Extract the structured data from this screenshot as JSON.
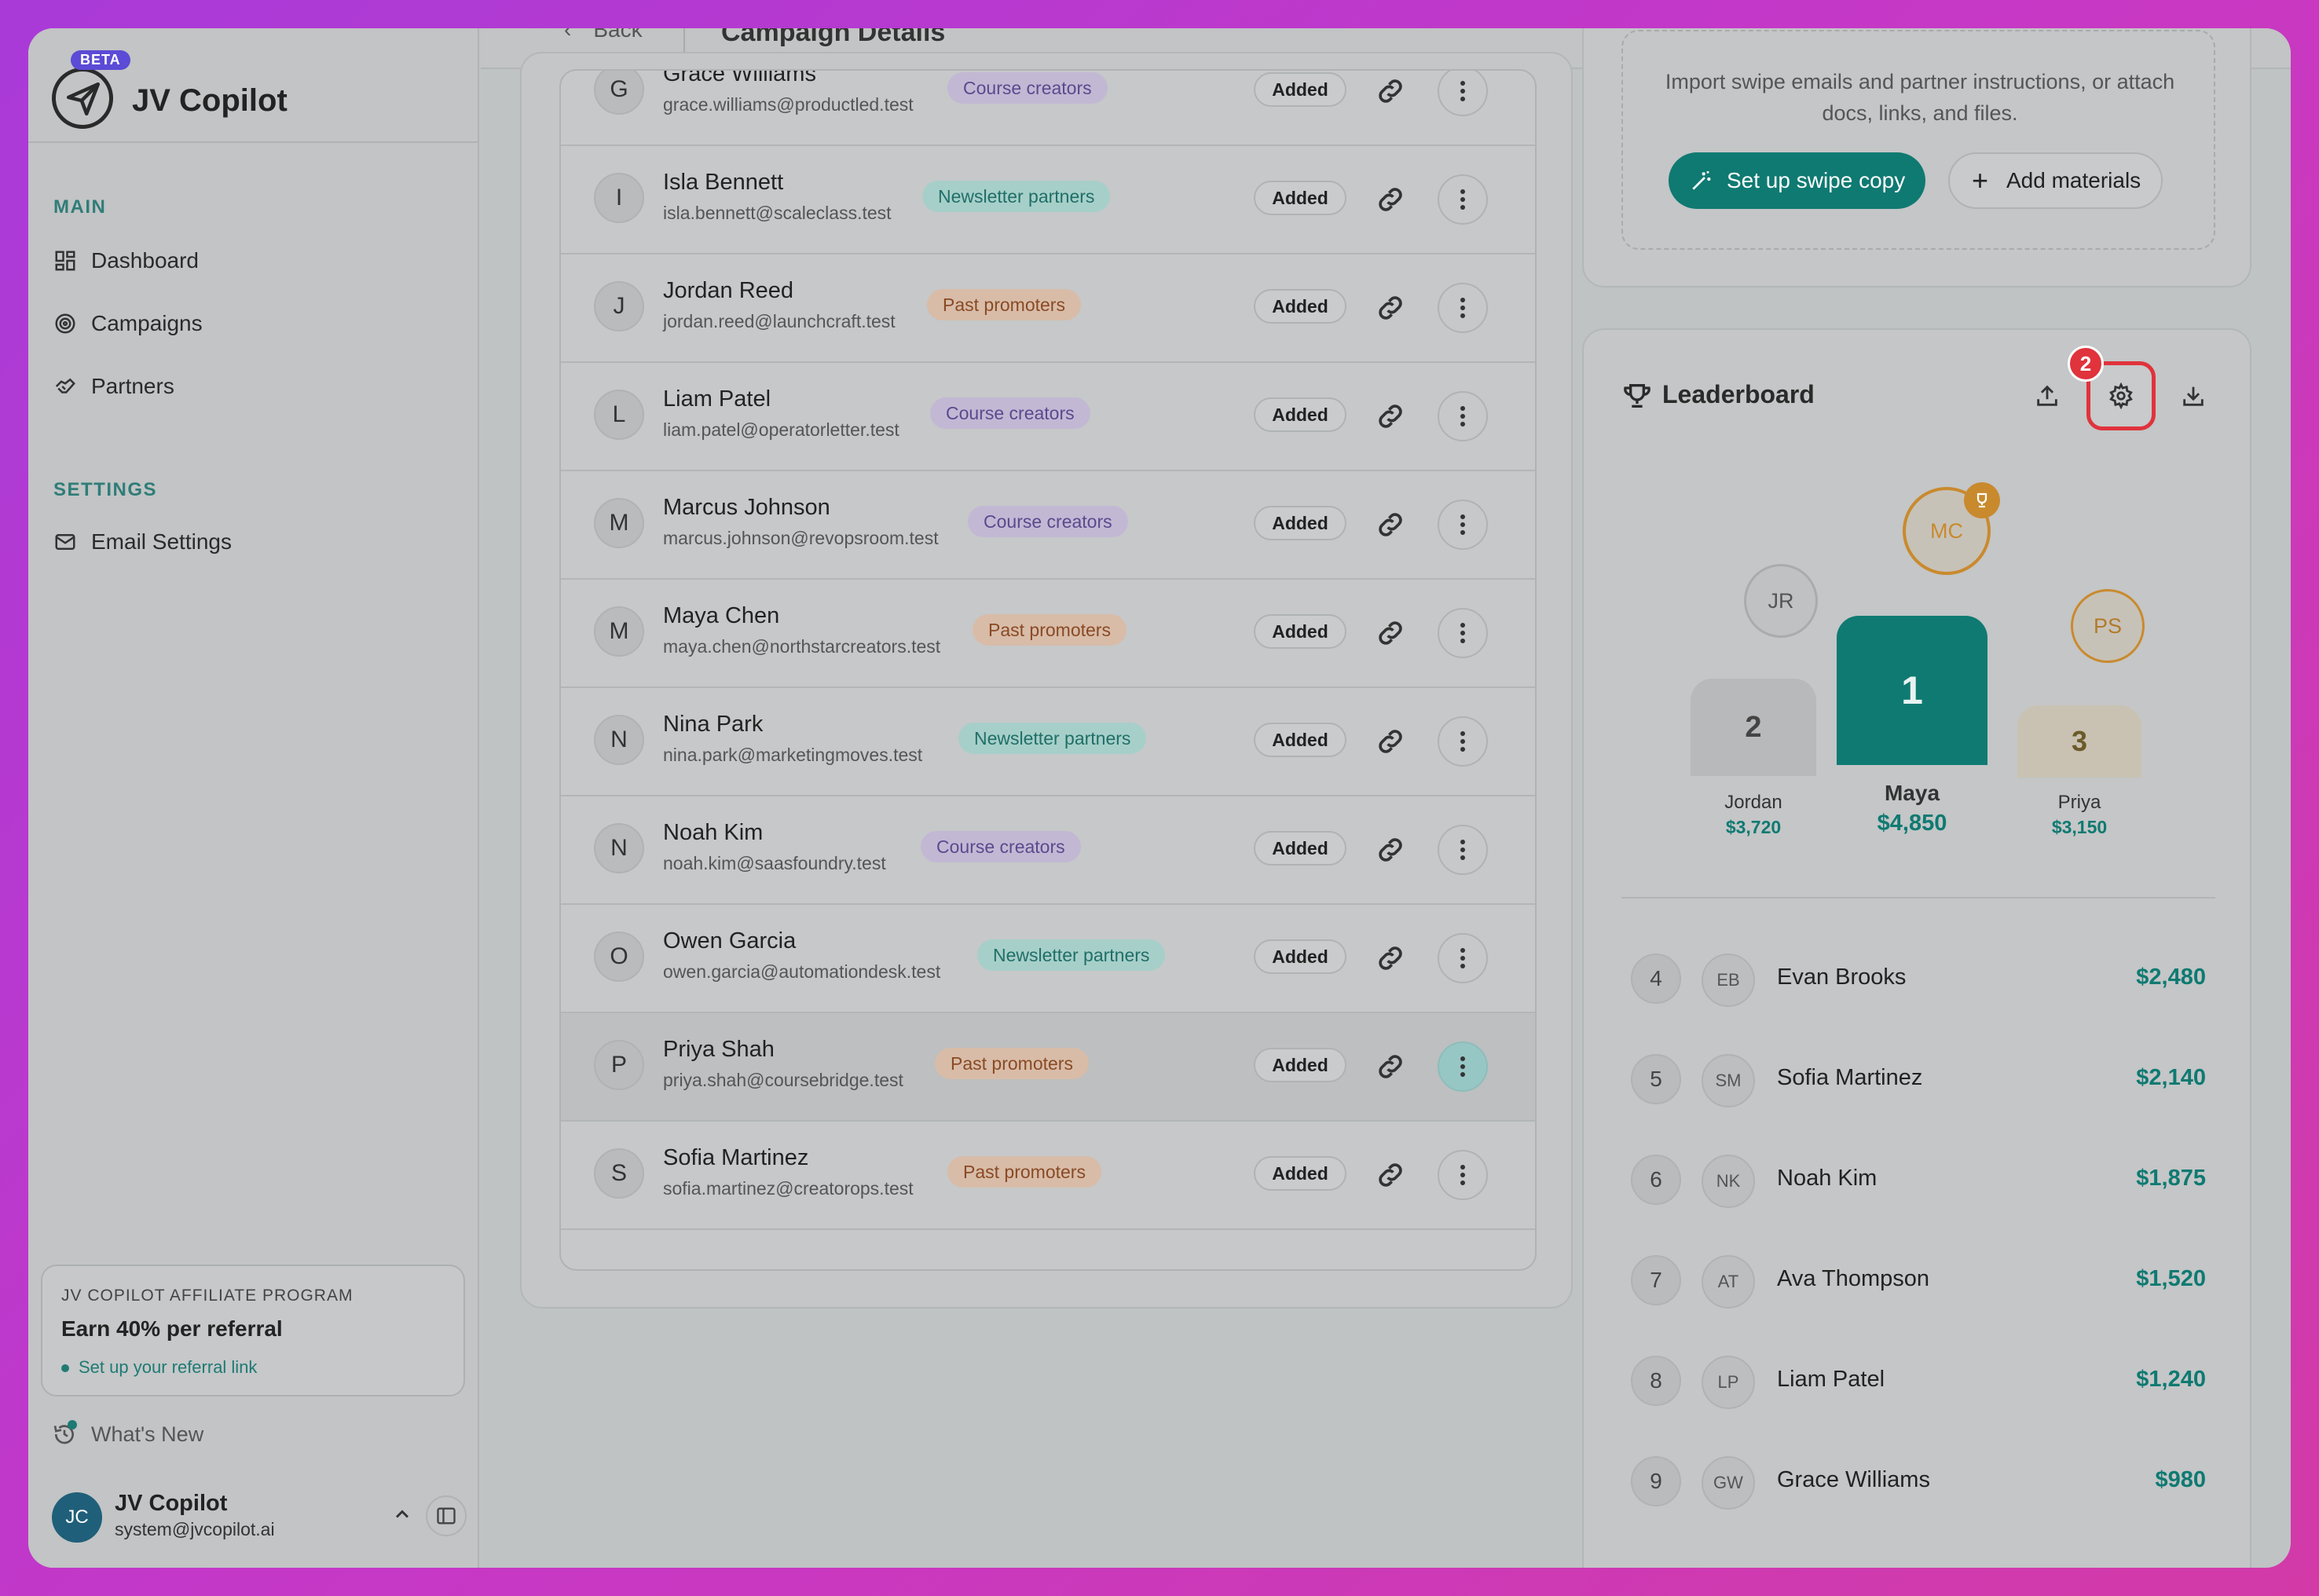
{
  "app": {
    "name": "JV Copilot",
    "beta_label": "BETA"
  },
  "sidebar": {
    "main_label": "MAIN",
    "main_items": [
      {
        "label": "Dashboard",
        "icon": "dashboard-icon"
      },
      {
        "label": "Campaigns",
        "icon": "target-icon"
      },
      {
        "label": "Partners",
        "icon": "handshake-icon"
      }
    ],
    "settings_label": "SETTINGS",
    "settings_items": [
      {
        "label": "Email Settings",
        "icon": "mail-icon"
      }
    ],
    "affiliate": {
      "label": "JV COPILOT AFFILIATE PROGRAM",
      "title": "Earn 40% per referral",
      "link": "Set up your referral link"
    },
    "whats_new": "What's New",
    "user": {
      "initials": "JC",
      "name": "JV Copilot",
      "email": "system@jvcopilot.ai"
    }
  },
  "header": {
    "back_label": "Back",
    "title": "Campaign Details"
  },
  "partners": [
    {
      "initial": "G",
      "name": "Grace Williams",
      "email": "grace.williams@productled.test",
      "tag": "Course creators",
      "tag_color": "purple",
      "status": "Added"
    },
    {
      "initial": "I",
      "name": "Isla Bennett",
      "email": "isla.bennett@scaleclass.test",
      "tag": "Newsletter partners",
      "tag_color": "teal",
      "status": "Added"
    },
    {
      "initial": "J",
      "name": "Jordan Reed",
      "email": "jordan.reed@launchcraft.test",
      "tag": "Past promoters",
      "tag_color": "orange",
      "status": "Added"
    },
    {
      "initial": "L",
      "name": "Liam Patel",
      "email": "liam.patel@operatorletter.test",
      "tag": "Course creators",
      "tag_color": "purple",
      "status": "Added"
    },
    {
      "initial": "M",
      "name": "Marcus Johnson",
      "email": "marcus.johnson@revopsroom.test",
      "tag": "Course creators",
      "tag_color": "purple",
      "status": "Added"
    },
    {
      "initial": "M",
      "name": "Maya Chen",
      "email": "maya.chen@northstarcreators.test",
      "tag": "Past promoters",
      "tag_color": "orange",
      "status": "Added"
    },
    {
      "initial": "N",
      "name": "Nina Park",
      "email": "nina.park@marketingmoves.test",
      "tag": "Newsletter partners",
      "tag_color": "teal",
      "status": "Added"
    },
    {
      "initial": "N",
      "name": "Noah Kim",
      "email": "noah.kim@saasfoundry.test",
      "tag": "Course creators",
      "tag_color": "purple",
      "status": "Added"
    },
    {
      "initial": "O",
      "name": "Owen Garcia",
      "email": "owen.garcia@automationdesk.test",
      "tag": "Newsletter partners",
      "tag_color": "teal",
      "status": "Added"
    },
    {
      "initial": "P",
      "name": "Priya Shah",
      "email": "priya.shah@coursebridge.test",
      "tag": "Past promoters",
      "tag_color": "orange",
      "status": "Added"
    },
    {
      "initial": "S",
      "name": "Sofia Martinez",
      "email": "sofia.martinez@creatorops.test",
      "tag": "Past promoters",
      "tag_color": "orange",
      "status": "Added"
    }
  ],
  "materials": {
    "description": "Import swipe emails and partner instructions, or attach docs, links, and files.",
    "primary_button": "Set up swipe copy",
    "secondary_button": "Add materials"
  },
  "leaderboard": {
    "title": "Leaderboard",
    "notification_count": "2",
    "podium": [
      {
        "rank": "2",
        "initials": "JR",
        "name": "Jordan",
        "amount": "$3,720"
      },
      {
        "rank": "1",
        "initials": "MC",
        "name": "Maya",
        "amount": "$4,850"
      },
      {
        "rank": "3",
        "initials": "PS",
        "name": "Priya",
        "amount": "$3,150"
      }
    ],
    "ranks": [
      {
        "rank": "4",
        "initials": "EB",
        "name": "Evan Brooks",
        "amount": "$2,480"
      },
      {
        "rank": "5",
        "initials": "SM",
        "name": "Sofia Martinez",
        "amount": "$2,140"
      },
      {
        "rank": "6",
        "initials": "NK",
        "name": "Noah Kim",
        "amount": "$1,875"
      },
      {
        "rank": "7",
        "initials": "AT",
        "name": "Ava Thompson",
        "amount": "$1,520"
      },
      {
        "rank": "8",
        "initials": "LP",
        "name": "Liam Patel",
        "amount": "$1,240"
      },
      {
        "rank": "9",
        "initials": "GW",
        "name": "Grace Williams",
        "amount": "$980"
      }
    ]
  },
  "colors": {
    "accent": "#0f7a72",
    "highlight": "#e0333c",
    "gold": "#c98a2e"
  }
}
